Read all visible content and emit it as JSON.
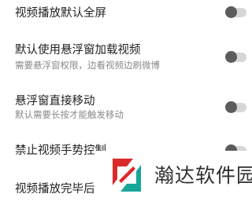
{
  "settings": [
    {
      "title": "视频播放默认全屏",
      "subtitle": "",
      "toggle_on": false
    },
    {
      "title": "默认使用悬浮窗加载视频",
      "subtitle": "需要悬浮窗权限，边看视频边刷微博",
      "toggle_on": false
    },
    {
      "title": "悬浮窗直接移动",
      "subtitle": "默认需要长按才能触发移动",
      "toggle_on": false
    },
    {
      "title": "禁止视频手势控制",
      "subtitle": "",
      "toggle_on": false
    },
    {
      "title": "视频播放完毕后",
      "subtitle": ""
    }
  ],
  "watermark": {
    "text": "瀚达软件园",
    "logo_icon": "handa-logo-icon"
  },
  "colors": {
    "toggle_track": "#d6d6d6",
    "toggle_knob": "#5c5c5c",
    "logo_red": "#d92b2b",
    "logo_teal": "#16a79a"
  }
}
